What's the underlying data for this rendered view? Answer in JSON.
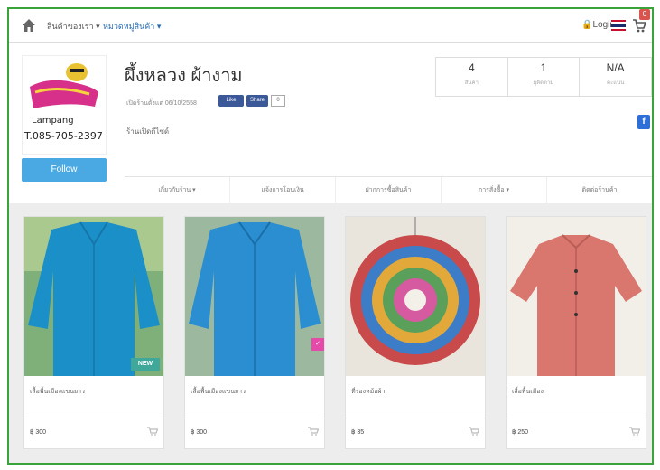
{
  "topnav": {
    "menu1": "สินค้าของเรา ▾",
    "menu2": "หมวดหมู่สินค้า ▾",
    "login": "Login",
    "cart_count": "0"
  },
  "shop": {
    "name": "ผึ้งหลวง ผ้างาม",
    "meta": "เปิดร้านตั้งแต่ 06/10/2558",
    "like": "Like",
    "share": "Share",
    "like_count": "0",
    "desc": "ร้านเปิดดีไซด์",
    "follow": "Follow",
    "logo_line1": "Lampang",
    "logo_line2": "T.085-705-2397",
    "stats": [
      {
        "num": "4",
        "label": "สินค้า"
      },
      {
        "num": "1",
        "label": "ผู้ติดตาม"
      },
      {
        "num": "N/A",
        "label": "คะแนน"
      }
    ],
    "tabs": [
      "เกี่ยวกับร้าน ▾",
      "แจ้งการโอนเงิน",
      "ฝากการซื้อสินค้า",
      "การสั่งซื้อ ▾",
      "ติดต่อร้านค้า"
    ]
  },
  "products": [
    {
      "name": "เสื้อพื้นเมืองแขนยาว",
      "price": "฿ 300",
      "badge": "NEW",
      "color": "#1b8fc8"
    },
    {
      "name": "เสื้อพื้นเมืองแขนยาว",
      "price": "฿ 300",
      "badge": "",
      "color": "#2a8ed0"
    },
    {
      "name": "ที่รองหม้อผ้า",
      "price": "฿ 35",
      "badge": "",
      "color": "#c84a4a"
    },
    {
      "name": "เสื้อพื้นเมือง",
      "price": "฿ 250",
      "badge": "",
      "color": "#d9776e"
    }
  ]
}
